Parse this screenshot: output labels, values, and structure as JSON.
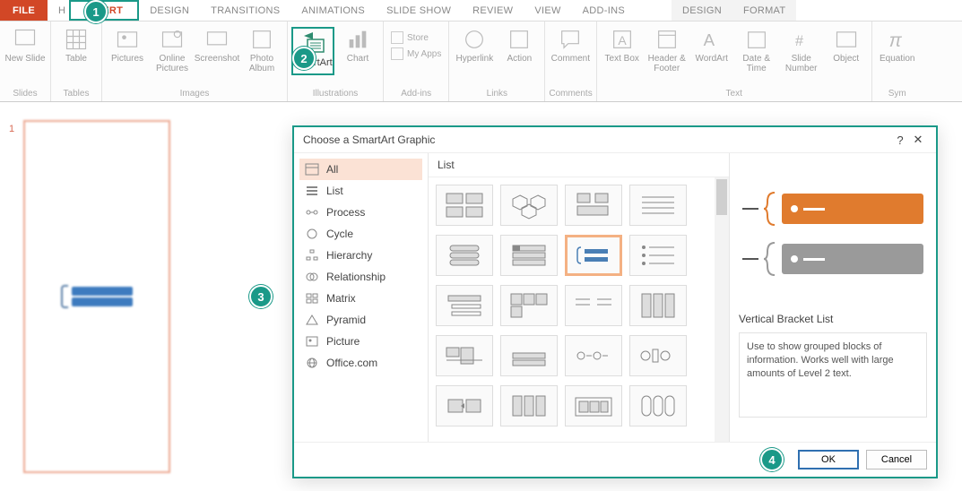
{
  "tabs": {
    "file": "FILE",
    "insert": "INSERT",
    "design": "DESIGN",
    "transitions": "TRANSITIONS",
    "animations": "ANIMATIONS",
    "slideshow": "SLIDE SHOW",
    "review": "REVIEW",
    "view": "VIEW",
    "addins": "ADD-INS",
    "ctx_design": "DESIGN",
    "ctx_format": "FORMAT"
  },
  "ribbon": {
    "slides": {
      "new_slide": "New Slide",
      "label": "Slides"
    },
    "tables": {
      "table": "Table",
      "label": "Tables"
    },
    "images": {
      "pictures": "Pictures",
      "online_pictures": "Online Pictures",
      "screenshot": "Screenshot",
      "photo_album": "Photo Album",
      "label": "Images"
    },
    "illustrations": {
      "smartart": "SmartArt",
      "chart": "Chart",
      "label": "Illustrations"
    },
    "apps": {
      "store": "Store",
      "my_apps": "My Apps",
      "label": "Add-ins"
    },
    "links": {
      "hyperlink": "Hyperlink",
      "action": "Action",
      "label": "Links"
    },
    "comments": {
      "comment": "Comment",
      "label": "Comments"
    },
    "text": {
      "text_box": "Text Box",
      "header_footer": "Header & Footer",
      "wordart": "WordArt",
      "date_time": "Date & Time",
      "slide_number": "Slide Number",
      "object": "Object",
      "label": "Text"
    },
    "symbols": {
      "equation": "Equation",
      "label": "Sym"
    }
  },
  "slidepanel": {
    "num": "1"
  },
  "dialog": {
    "title": "Choose a SmartArt Graphic",
    "help": "?",
    "close": "✕",
    "categories": [
      {
        "key": "all",
        "label": "All"
      },
      {
        "key": "list",
        "label": "List"
      },
      {
        "key": "process",
        "label": "Process"
      },
      {
        "key": "cycle",
        "label": "Cycle"
      },
      {
        "key": "hierarchy",
        "label": "Hierarchy"
      },
      {
        "key": "relationship",
        "label": "Relationship"
      },
      {
        "key": "matrix",
        "label": "Matrix"
      },
      {
        "key": "pyramid",
        "label": "Pyramid"
      },
      {
        "key": "picture",
        "label": "Picture"
      },
      {
        "key": "office",
        "label": "Office.com"
      }
    ],
    "gallery_head": "List",
    "preview": {
      "name": "Vertical Bracket List",
      "desc": "Use to show grouped blocks of information.  Works well with large amounts of Level 2 text."
    },
    "ok": "OK",
    "cancel": "Cancel"
  },
  "badges": {
    "b1": "1",
    "b2": "2",
    "b3": "3",
    "b4": "4"
  }
}
